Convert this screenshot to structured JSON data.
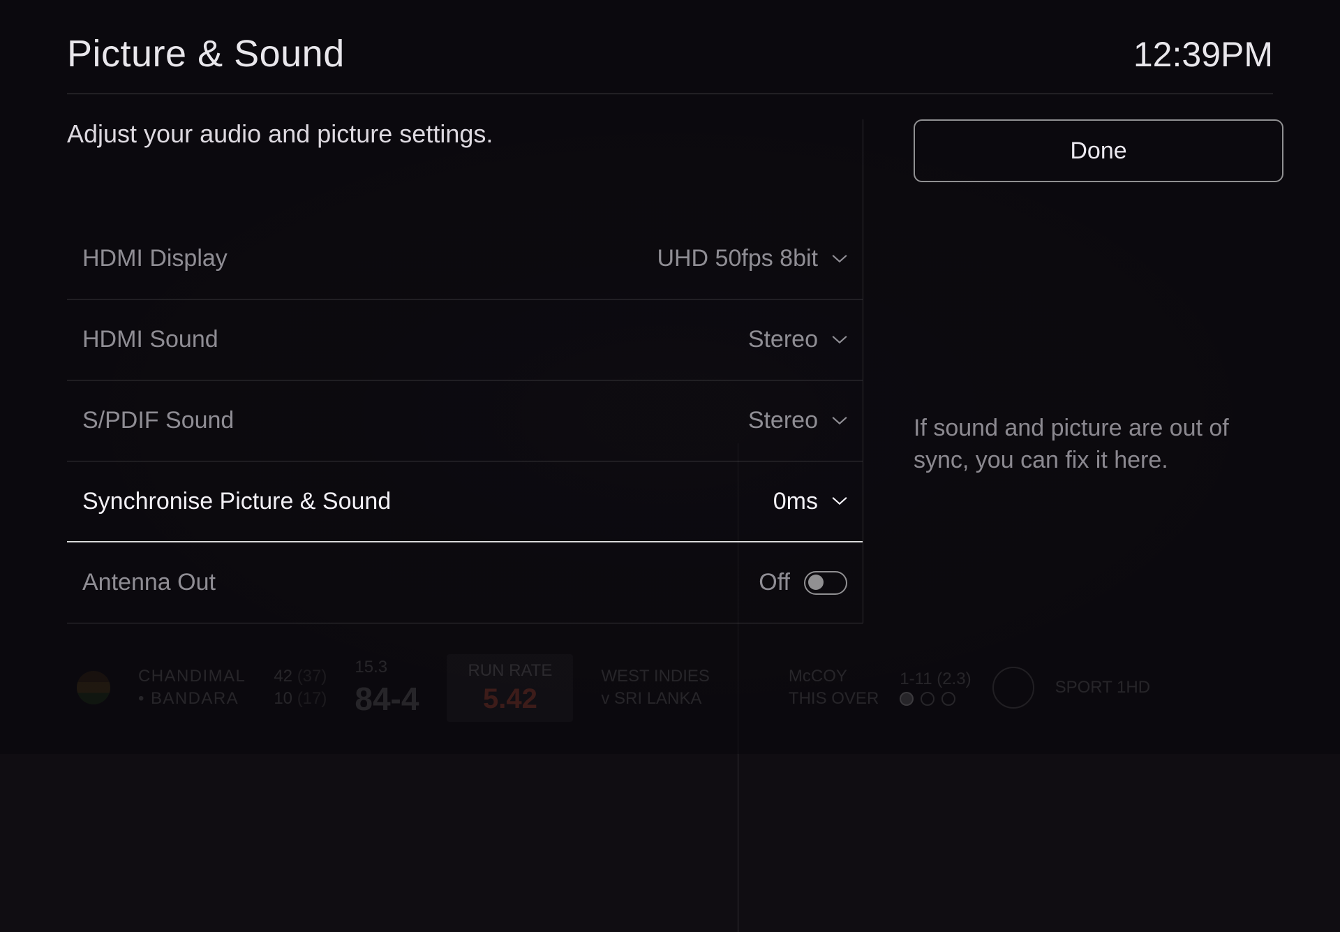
{
  "header": {
    "title": "Picture & Sound",
    "clock": "12:39PM"
  },
  "description": "Adjust your audio and picture settings.",
  "done_label": "Done",
  "hint": "If sound and picture are out of sync, you can fix it here.",
  "rows": {
    "hdmi_display": {
      "label": "HDMI Display",
      "value": "UHD 50fps 8bit"
    },
    "hdmi_sound": {
      "label": "HDMI Sound",
      "value": "Stereo"
    },
    "spdif_sound": {
      "label": "S/PDIF Sound",
      "value": "Stereo"
    },
    "sync": {
      "label": "Synchronise Picture & Sound",
      "value": "0ms"
    },
    "antenna_out": {
      "label": "Antenna Out",
      "value": "Off"
    }
  },
  "scoreboard": {
    "batsman1": "CHANDIMAL",
    "batsman1_figs": "42",
    "batsman1_balls": "(37)",
    "batsman2": "BANDARA",
    "batsman2_figs": "10",
    "batsman2_balls": "(17)",
    "overs": "15.3",
    "score": "84-4",
    "run_rate_label": "RUN RATE",
    "run_rate": "5.42",
    "match_label": "WEST INDIES",
    "match_sub": "v SRI LANKA",
    "bowler": "McCOY",
    "bowler_figs": "1-11",
    "bowler_overs": "(2.3)",
    "this_over_label": "THIS OVER",
    "channel": "SPORT 1HD"
  }
}
